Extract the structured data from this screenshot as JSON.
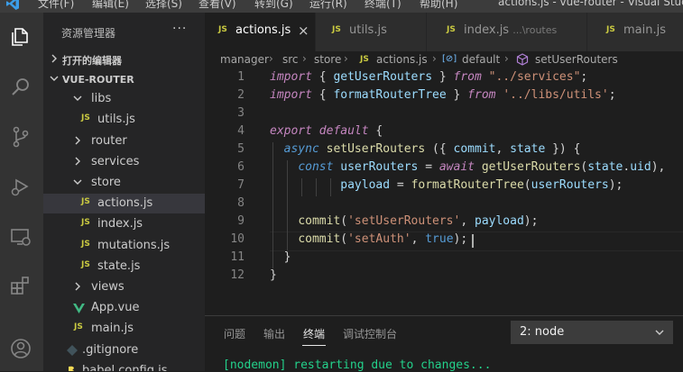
{
  "titlebar": {
    "menus": [
      "文件(F)",
      "编辑(E)",
      "选择(S)",
      "查看(V)",
      "转到(G)",
      "运行(R)",
      "终端(T)",
      "帮助(H)"
    ],
    "window_title": "actions.js - vue-router - Visual Studio"
  },
  "activity_icons": [
    "explorer-icon",
    "search-icon",
    "source-control-icon",
    "run-debug-icon",
    "remote-explorer-icon",
    "extensions-icon",
    "account-icon"
  ],
  "sidebar": {
    "title": "资源管理器",
    "more": "···",
    "open_editors": "打开的编辑器",
    "workspace": "VUE-ROUTER",
    "items": [
      {
        "label": "libs",
        "kind": "folder-open"
      },
      {
        "label": "utils.js",
        "kind": "js"
      },
      {
        "label": "router",
        "kind": "folder"
      },
      {
        "label": "services",
        "kind": "folder"
      },
      {
        "label": "store",
        "kind": "folder-open"
      },
      {
        "label": "actions.js",
        "kind": "js",
        "selected": true
      },
      {
        "label": "index.js",
        "kind": "js"
      },
      {
        "label": "mutations.js",
        "kind": "js"
      },
      {
        "label": "state.js",
        "kind": "js"
      },
      {
        "label": "views",
        "kind": "folder"
      },
      {
        "label": "App.vue",
        "kind": "vue"
      },
      {
        "label": "main.js",
        "kind": "js"
      },
      {
        "label": ".gitignore",
        "kind": "git"
      },
      {
        "label": "babel.config.js",
        "kind": "babel"
      }
    ]
  },
  "tabs": [
    {
      "label": "actions.js",
      "active": true,
      "close": "×"
    },
    {
      "label": "utils.js"
    },
    {
      "label": "index.js",
      "hint": "...\\routes"
    },
    {
      "label": "main.js"
    }
  ],
  "js_badge": "JS",
  "breadcrumb": {
    "parts": [
      "manager",
      "src",
      "store",
      "actions.js",
      "default",
      "setUserRouters"
    ],
    "separator": "›",
    "default_icon_text": "[⊘]"
  },
  "editor": {
    "line_numbers": [
      "1",
      "2",
      "3",
      "4",
      "5",
      "6",
      "7",
      "8",
      "9",
      "10",
      "11",
      "12"
    ],
    "code": {
      "import": "import",
      "from": "from",
      "export": "export",
      "default": "default",
      "async": "async",
      "const": "const",
      "await": "await",
      "getUserRouters": "getUserRouters",
      "formatRouterTree": "formatRouterTree",
      "services_path": "\"../services\"",
      "utils_path": "'../libs/utils'",
      "setUserRouters": "setUserRouters",
      "commit": "commit",
      "state": "state",
      "userRouters": "userRouters",
      "payload": "payload",
      "set_user_routers_str": "'setUserRouters'",
      "set_auth_str": "'setAuth'",
      "true": "true",
      "uid": "uid"
    }
  },
  "panel": {
    "tabs": [
      "问题",
      "输出",
      "终端",
      "调试控制台"
    ],
    "active_tab": "终端",
    "terminal_select": "2: node",
    "terminal_output": "[nodemon] restarting due to changes..."
  },
  "colors": {
    "accent_blue": "#569cd6",
    "keyword_purple": "#c586c0",
    "function_yellow": "#dcdcaa",
    "string_orange": "#ce9178",
    "variable_blue": "#9cdcfe",
    "js_yellow": "#cbcb41",
    "terminal_green": "#23d18b"
  }
}
